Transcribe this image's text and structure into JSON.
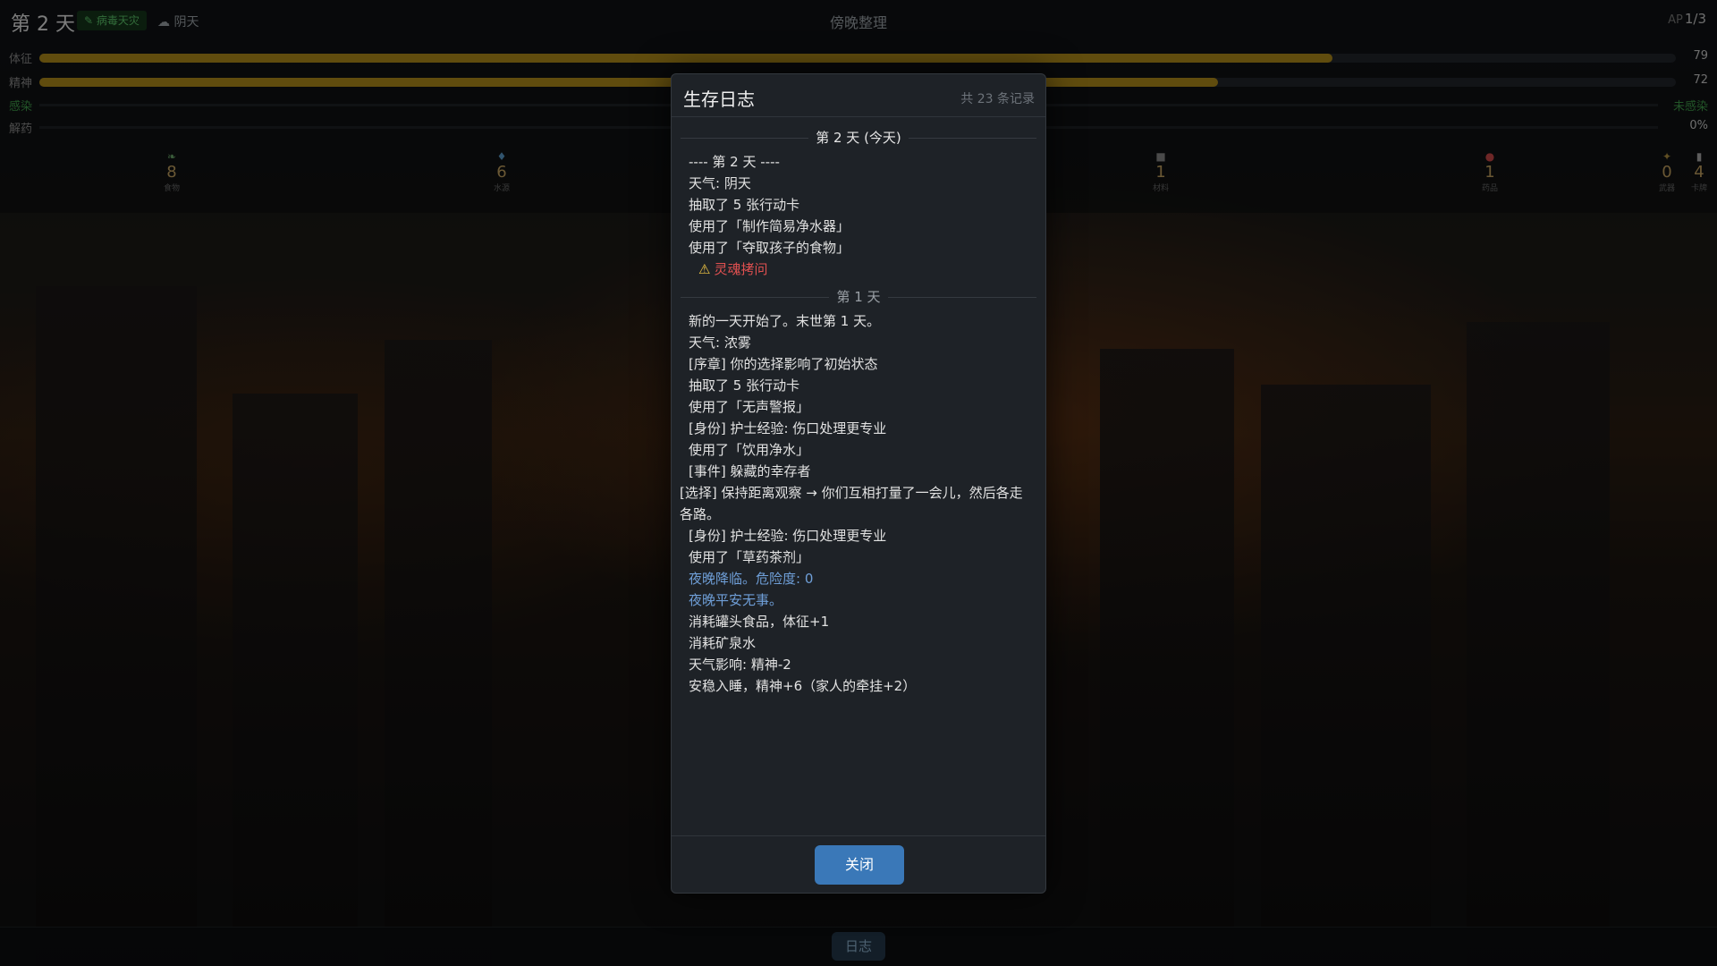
{
  "hud": {
    "day_title": "第 2 天",
    "tag_virus": "病毒天灾",
    "weather": "阴天",
    "phase": "傍晚整理",
    "ap_label": "AP",
    "ap_value": "1/3",
    "stats": [
      {
        "label": "体征",
        "value": "79",
        "percent": 79
      },
      {
        "label": "精神",
        "value": "72",
        "percent": 72
      }
    ],
    "infection": {
      "label": "感染",
      "status": "未感染"
    },
    "antidote": {
      "label": "解药",
      "value": "0%"
    },
    "resources": [
      {
        "value": "8",
        "label": "食物",
        "icon": "leaf-icon"
      },
      {
        "value": "6",
        "label": "水源",
        "icon": "drop-icon"
      },
      {
        "value": "1",
        "label": "材料",
        "icon": "box-icon"
      },
      {
        "value": "1",
        "label": "药品",
        "icon": "pill-icon"
      },
      {
        "value": "0",
        "label": "武器",
        "icon": "knife-icon"
      },
      {
        "value": "4",
        "label": "卡牌",
        "icon": "card-icon"
      }
    ]
  },
  "modal": {
    "title": "生存日志",
    "count": "共 23 条记录",
    "close_label": "关闭",
    "days": [
      {
        "header": "第 2 天 (今天)",
        "entries": [
          {
            "text": "---- 第 2 天 ----",
            "kind": "normal"
          },
          {
            "text": "天气: 阴天",
            "kind": "normal"
          },
          {
            "text": "抽取了 5 张行动卡",
            "kind": "normal"
          },
          {
            "text": "使用了「制作简易净水器」",
            "kind": "normal"
          },
          {
            "text": "使用了「夺取孩子的食物」",
            "kind": "normal"
          },
          {
            "text": "灵魂拷问",
            "kind": "warn"
          }
        ]
      },
      {
        "header": "第 1 天",
        "entries": [
          {
            "text": "新的一天开始了。末世第 1 天。",
            "kind": "normal"
          },
          {
            "text": "天气: 浓雾",
            "kind": "normal"
          },
          {
            "text": "[序章] 你的选择影响了初始状态",
            "kind": "normal"
          },
          {
            "text": "抽取了 5 张行动卡",
            "kind": "normal"
          },
          {
            "text": "使用了「无声警报」",
            "kind": "normal"
          },
          {
            "text": "[身份] 护士经验: 伤口处理更专业",
            "kind": "normal"
          },
          {
            "text": "使用了「饮用净水」",
            "kind": "normal"
          },
          {
            "text": "[事件] 躲藏的幸存者",
            "kind": "normal"
          },
          {
            "text": "[选择] 保持距离观察 → 你们互相打量了一会儿，然后各走各路。",
            "kind": "choice"
          },
          {
            "text": "[身份] 护士经验: 伤口处理更专业",
            "kind": "normal"
          },
          {
            "text": "使用了「草药茶剂」",
            "kind": "normal"
          },
          {
            "text": "夜晚降临。危险度: 0",
            "kind": "night"
          },
          {
            "text": "夜晚平安无事。",
            "kind": "night"
          },
          {
            "text": "消耗罐头食品，体征+1",
            "kind": "normal"
          },
          {
            "text": "消耗矿泉水",
            "kind": "normal"
          },
          {
            "text": "天气影响: 精神-2",
            "kind": "normal"
          },
          {
            "text": "安稳入睡，精神+6（家人的牵挂+2）",
            "kind": "normal"
          }
        ]
      }
    ]
  },
  "bottom": {
    "log_label": "日志"
  },
  "colors": {
    "accent": "#3a78b8",
    "stat_fill": "#b08a1a",
    "warn": "#e05050",
    "night": "#6f9fd8",
    "virus_tag": "#5cc56a"
  }
}
